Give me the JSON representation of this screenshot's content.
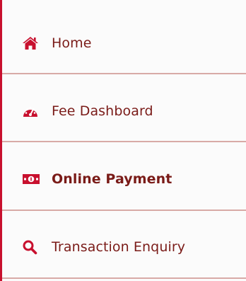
{
  "nav": {
    "items": [
      {
        "label": "Home",
        "icon": "home-icon"
      },
      {
        "label": "Fee Dashboard",
        "icon": "tachometer-icon"
      },
      {
        "label": "Online Payment",
        "icon": "money-bill-icon",
        "active": true
      },
      {
        "label": "Transaction Enquiry",
        "icon": "search-icon"
      }
    ]
  },
  "colors": {
    "accent": "#c8102e",
    "text": "#7a1b18",
    "divider": "#d8aaa6"
  }
}
